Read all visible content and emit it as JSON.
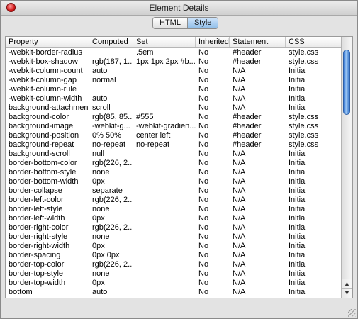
{
  "window": {
    "title": "Element Details"
  },
  "tabs": [
    {
      "label": "HTML",
      "active": false
    },
    {
      "label": "Style",
      "active": true
    }
  ],
  "columns": [
    "Property",
    "Computed",
    "Set",
    "Inherited",
    "Statement",
    "CSS"
  ],
  "rows": [
    [
      "-webkit-border-radius",
      "",
      ".5em",
      "No",
      "#header",
      "style.css"
    ],
    [
      "-webkit-box-shadow",
      "rgb(187, 1...",
      "1px 1px 2px #b...",
      "No",
      "#header",
      "style.css"
    ],
    [
      "-webkit-column-count",
      "auto",
      "",
      "No",
      "N/A",
      "Initial"
    ],
    [
      "-webkit-column-gap",
      "normal",
      "",
      "No",
      "N/A",
      "Initial"
    ],
    [
      "-webkit-column-rule",
      "",
      "",
      "No",
      "N/A",
      "Initial"
    ],
    [
      "-webkit-column-width",
      "auto",
      "",
      "No",
      "N/A",
      "Initial"
    ],
    [
      "background-attachment",
      "scroll",
      "",
      "No",
      "N/A",
      "Initial"
    ],
    [
      "background-color",
      "rgb(85, 85...",
      "#555",
      "No",
      "#header",
      "style.css"
    ],
    [
      "background-image",
      "-webkit-g...",
      "-webkit-gradien...",
      "No",
      "#header",
      "style.css"
    ],
    [
      "background-position",
      "0% 50%",
      "center left",
      "No",
      "#header",
      "style.css"
    ],
    [
      "background-repeat",
      "no-repeat",
      "no-repeat",
      "No",
      "#header",
      "style.css"
    ],
    [
      "background-scroll",
      "null",
      "",
      "No",
      "N/A",
      "Initial"
    ],
    [
      "border-bottom-color",
      "rgb(226, 2...",
      "",
      "No",
      "N/A",
      "Initial"
    ],
    [
      "border-bottom-style",
      "none",
      "",
      "No",
      "N/A",
      "Initial"
    ],
    [
      "border-bottom-width",
      "0px",
      "",
      "No",
      "N/A",
      "Initial"
    ],
    [
      "border-collapse",
      "separate",
      "",
      "No",
      "N/A",
      "Initial"
    ],
    [
      "border-left-color",
      "rgb(226, 2...",
      "",
      "No",
      "N/A",
      "Initial"
    ],
    [
      "border-left-style",
      "none",
      "",
      "No",
      "N/A",
      "Initial"
    ],
    [
      "border-left-width",
      "0px",
      "",
      "No",
      "N/A",
      "Initial"
    ],
    [
      "border-right-color",
      "rgb(226, 2...",
      "",
      "No",
      "N/A",
      "Initial"
    ],
    [
      "border-right-style",
      "none",
      "",
      "No",
      "N/A",
      "Initial"
    ],
    [
      "border-right-width",
      "0px",
      "",
      "No",
      "N/A",
      "Initial"
    ],
    [
      "border-spacing",
      "0px 0px",
      "",
      "No",
      "N/A",
      "Initial"
    ],
    [
      "border-top-color",
      "rgb(226, 2...",
      "",
      "No",
      "N/A",
      "Initial"
    ],
    [
      "border-top-style",
      "none",
      "",
      "No",
      "N/A",
      "Initial"
    ],
    [
      "border-top-width",
      "0px",
      "",
      "No",
      "N/A",
      "Initial"
    ],
    [
      "bottom",
      "auto",
      "",
      "No",
      "N/A",
      "Initial"
    ]
  ],
  "icons": {
    "close": "close-icon",
    "scroll_up": "arrow-up-icon",
    "scroll_down": "arrow-down-icon",
    "resize": "resize-grip-icon"
  },
  "colors": {
    "selected_tab": "#8fbde8",
    "scroll_thumb": "#3f7fd7",
    "close_button": "#d21a1a"
  }
}
